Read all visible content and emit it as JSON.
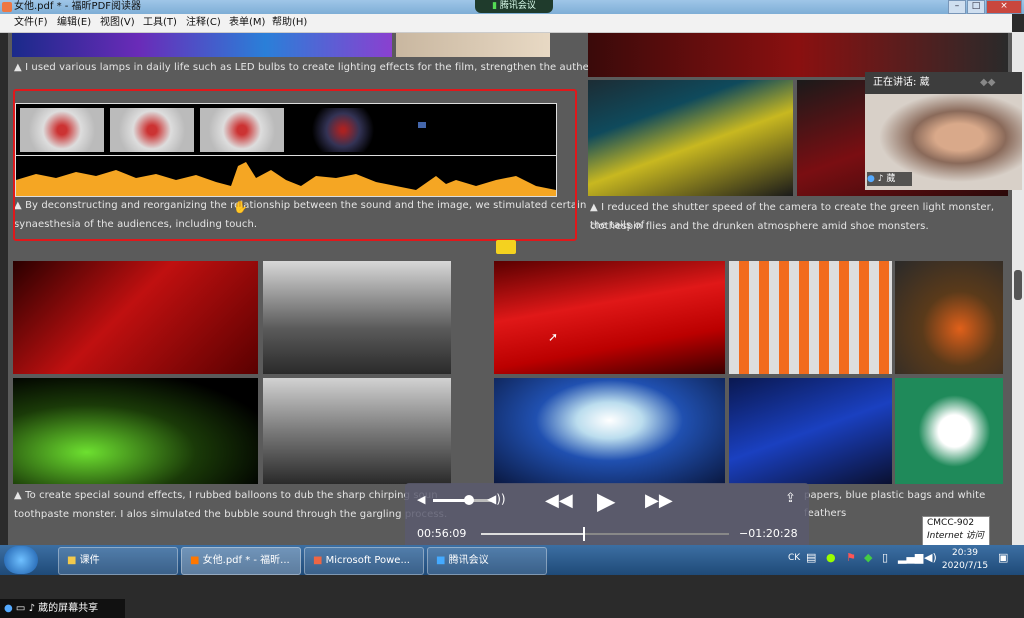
{
  "window": {
    "title": "女他.pdf * - 福昕PDF阅读器",
    "meeting_label": "腾讯会议",
    "controls": [
      "–",
      "□",
      "×"
    ]
  },
  "menu": [
    "文件(F)",
    "编辑(E)",
    "视图(V)",
    "工具(T)",
    "注释(C)",
    "表单(M)",
    "帮助(H)"
  ],
  "captions": {
    "c1": "▲ I used various lamps in daily life such as LED bulbs to create lighting effects for the film, strengthen the authenticity.",
    "c2a": "▲ By deconstructing and reorganizing the relationship between the sound and the image, we stimulated certain",
    "c2b": "synaesthesia of the audiences, including touch.",
    "c3a": "▲ I reduced the shutter speed of the camera to create the green light monster, the tails of",
    "c3b": "clothespin flies and the drunken atmosphere amid shoe monsters.",
    "c4a": "▲ To create special sound effects, I rubbed balloons to dub the sharp chirping soun",
    "c4b": "toothpaste monster. I alos simulated the bubble sound through the gargling process.",
    "c5": "papers, blue plastic bags and white feathers"
  },
  "video": {
    "speaking_label": "正在讲话:",
    "speaker": "葳",
    "name_tag": "葳"
  },
  "player": {
    "elapsed": "00:56:09",
    "remaining": "−01:20:28",
    "progress": 0.41,
    "volume": 0.6
  },
  "tooltip": {
    "line1": "CMCC-902",
    "line2": "Internet 访问"
  },
  "taskbar": {
    "items": [
      "课件",
      "女他.pdf * - 福昕...",
      "Microsoft Powe...",
      "腾讯会议"
    ],
    "time": "20:39",
    "date": "2020/7/15",
    "lang": "CK"
  },
  "share_bar": {
    "label": "葳的屏幕共享"
  },
  "colors": {
    "highlight": "#e0181b",
    "waveform": "#f5a623",
    "accent_blue": "#2d6fb5"
  }
}
